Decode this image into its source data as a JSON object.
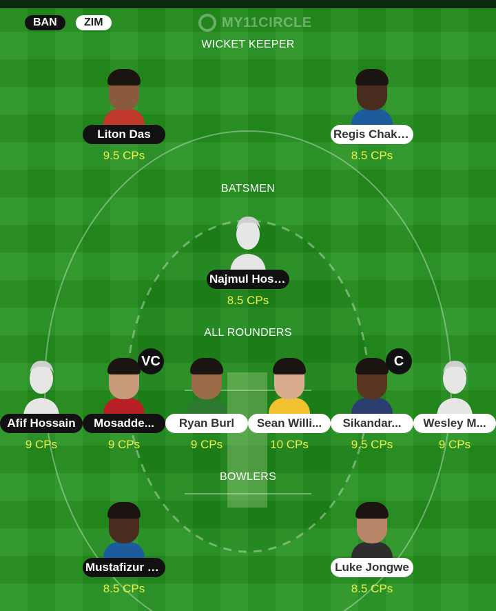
{
  "teams": {
    "team1": "BAN",
    "team2": "ZIM"
  },
  "brand": {
    "logo_text": "MY11CIRCLE"
  },
  "sections": {
    "wicket_keeper": "WICKET KEEPER",
    "batsmen": "BATSMEN",
    "all_rounders": "ALL ROUNDERS",
    "bowlers": "BOWLERS"
  },
  "players": {
    "wicket_keeper": [
      {
        "name": "Liton Das",
        "credits": "9.5 CPs",
        "team": "BAN",
        "photo": "photo"
      },
      {
        "name": "Regis Chaka...",
        "credits": "8.5 CPs",
        "team": "ZIM",
        "photo": "photo"
      }
    ],
    "batsmen": [
      {
        "name": "Najmul Hossain",
        "credits": "8.5 CPs",
        "team": "BAN",
        "photo": "silhouette"
      }
    ],
    "all_rounders": [
      {
        "name": "Afif Hossain",
        "credits": "9 CPs",
        "team": "BAN",
        "photo": "silhouette"
      },
      {
        "name": "Mosadde...",
        "credits": "9 CPs",
        "team": "BAN",
        "photo": "photo",
        "badge": "VC"
      },
      {
        "name": "Ryan Burl",
        "credits": "9 CPs",
        "team": "ZIM",
        "photo": "photo"
      },
      {
        "name": "Sean Willi...",
        "credits": "10 CPs",
        "team": "ZIM",
        "photo": "photo"
      },
      {
        "name": "Sikandar...",
        "credits": "9.5 CPs",
        "team": "ZIM",
        "photo": "photo",
        "badge": "C"
      },
      {
        "name": "Wesley M...",
        "credits": "9 CPs",
        "team": "ZIM",
        "photo": "silhouette"
      }
    ],
    "bowlers": [
      {
        "name": "Mustafizur R...",
        "credits": "8.5 CPs",
        "team": "BAN",
        "photo": "photo"
      },
      {
        "name": "Luke Jongwe",
        "credits": "8.5 CPs",
        "team": "ZIM",
        "photo": "photo"
      }
    ]
  },
  "colors": {
    "pitch_green": "#24921f",
    "credit_yellow": "#f0f04a",
    "ban_pill": "#111111",
    "zim_pill": "#ffffff"
  }
}
